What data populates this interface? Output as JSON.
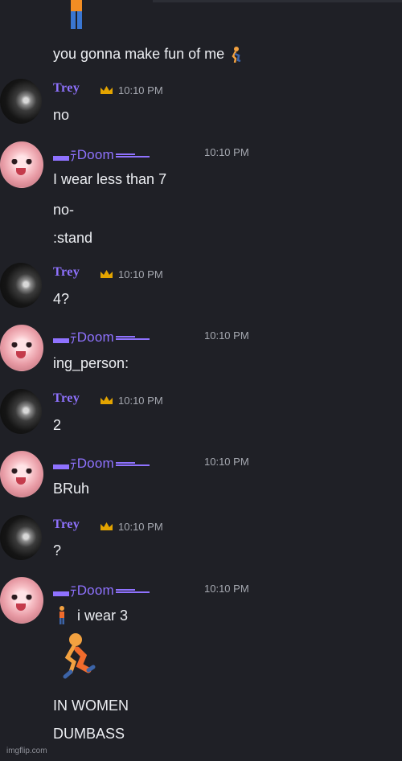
{
  "messages": [
    {
      "type": "continuation",
      "text": "you gonna make fun of me",
      "emoji": "running-person-icon"
    },
    {
      "type": "group",
      "user": "Trey",
      "time": "10:10 PM",
      "lines": [
        "no"
      ]
    },
    {
      "type": "group",
      "user": "Doom",
      "time": "10:10 PM",
      "lines": [
        "I wear less than 7",
        "no-",
        ":stand"
      ]
    },
    {
      "type": "group",
      "user": "Trey",
      "time": "10:10 PM",
      "lines": [
        "4?"
      ]
    },
    {
      "type": "group",
      "user": "Doom",
      "time": "10:10 PM",
      "lines": [
        "ing_person:"
      ]
    },
    {
      "type": "group",
      "user": "Trey",
      "time": "10:10 PM",
      "lines": [
        "2"
      ]
    },
    {
      "type": "group",
      "user": "Doom",
      "time": "10:10 PM",
      "lines": [
        "BRuh"
      ]
    },
    {
      "type": "group",
      "user": "Trey",
      "time": "10:10 PM",
      "lines": [
        "?"
      ]
    },
    {
      "type": "group",
      "user": "Doom",
      "time": "10:10 PM",
      "lines": [
        "i wear 3",
        "",
        "IN WOMEN",
        "DUMBASS"
      ]
    }
  ],
  "users": {
    "trey": {
      "name": "Trey",
      "name_color": "#8f72ff"
    },
    "doom": {
      "name": "Doom",
      "name_color": "#8f72ff"
    }
  },
  "watermark": "imgflip.com"
}
